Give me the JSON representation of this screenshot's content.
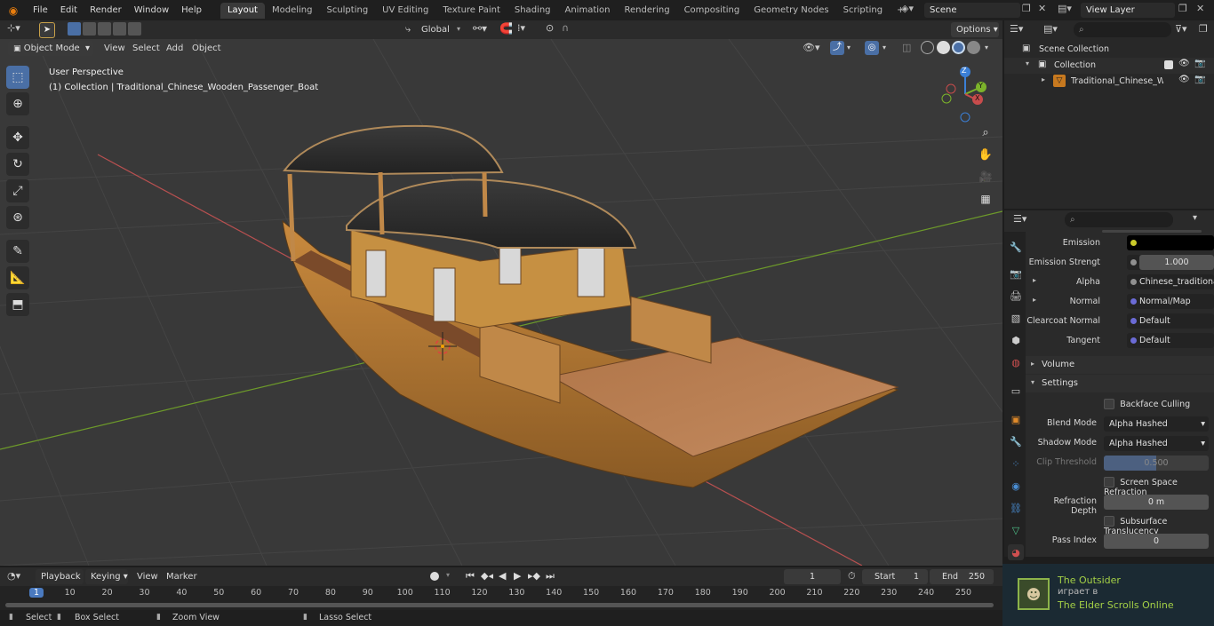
{
  "topbar": {
    "menus": [
      "File",
      "Edit",
      "Render",
      "Window",
      "Help"
    ],
    "workspaces": [
      "Layout",
      "Modeling",
      "Sculpting",
      "UV Editing",
      "Texture Paint",
      "Shading",
      "Animation",
      "Rendering",
      "Compositing",
      "Geometry Nodes",
      "Scripting"
    ],
    "active_workspace": "Layout",
    "add_tab": "+",
    "scene": "Scene",
    "view_layer": "View Layer"
  },
  "viewport_header": {
    "mode": "Object Mode",
    "menus": [
      "View",
      "Select",
      "Add",
      "Object"
    ],
    "orientation": "Global",
    "options": "Options"
  },
  "viewport": {
    "perspective": "User Perspective",
    "collection_info": "(1) Collection | Traditional_Chinese_Wooden_Passenger_Boat",
    "gizmo": {
      "x": "X",
      "y": "Y",
      "z": "Z"
    }
  },
  "outliner": {
    "scene_collection": "Scene Collection",
    "collection": "Collection",
    "object": "Traditional_Chinese_Woc"
  },
  "properties": {
    "rows": [
      {
        "label": "Emission",
        "value": "",
        "socket": "#c9c92a",
        "type": "color"
      },
      {
        "label": "Emission Strengt",
        "value": "1.000",
        "socket": "#8f8f8f",
        "type": "num"
      },
      {
        "label": "Alpha",
        "value": "Chinese_traditional_...",
        "socket": "#8f8f8f",
        "type": "link",
        "expand": "▸"
      },
      {
        "label": "Normal",
        "value": "Normal/Map",
        "socket": "#6b6bd6",
        "type": "link",
        "expand": "▸"
      },
      {
        "label": "Clearcoat Normal",
        "value": "Default",
        "socket": "#6b6bd6",
        "type": "link"
      },
      {
        "label": "Tangent",
        "value": "Default",
        "socket": "#6b6bd6",
        "type": "link"
      }
    ],
    "sections": {
      "volume": "Volume",
      "settings": "Settings"
    },
    "settings": {
      "backface_culling": "Backface Culling",
      "blend_mode_label": "Blend Mode",
      "blend_mode": "Alpha Hashed",
      "shadow_mode_label": "Shadow Mode",
      "shadow_mode": "Alpha Hashed",
      "clip_threshold_label": "Clip Threshold",
      "clip_threshold": "0.500",
      "ssr": "Screen Space Refraction",
      "refraction_depth_label": "Refraction Depth",
      "refraction_depth": "0 m",
      "subsurface": "Subsurface Translucency",
      "pass_index_label": "Pass Index",
      "pass_index": "0"
    }
  },
  "timeline": {
    "menus": [
      "Playback",
      "Keying",
      "View",
      "Marker"
    ],
    "current_frame": "1",
    "start_label": "Start",
    "start": "1",
    "end_label": "End",
    "end": "250",
    "ticks": [
      "1",
      "10",
      "20",
      "30",
      "40",
      "50",
      "60",
      "70",
      "80",
      "90",
      "100",
      "110",
      "120",
      "130",
      "140",
      "150",
      "160",
      "170",
      "180",
      "190",
      "200",
      "210",
      "220",
      "230",
      "240",
      "250"
    ]
  },
  "statusbar": {
    "items": [
      "Select",
      "Box Select",
      "Zoom View",
      "Lasso Select"
    ]
  },
  "notification": {
    "title": "The Outsider",
    "subtitle": "играет в",
    "game": "The Elder Scrolls Online"
  },
  "colors": {
    "accent": "#4a6fa5",
    "active_frame": "#4a7ac0",
    "x_axis": "#c84c4c",
    "y_axis": "#7cb32b",
    "z_axis": "#3b7fd6"
  }
}
